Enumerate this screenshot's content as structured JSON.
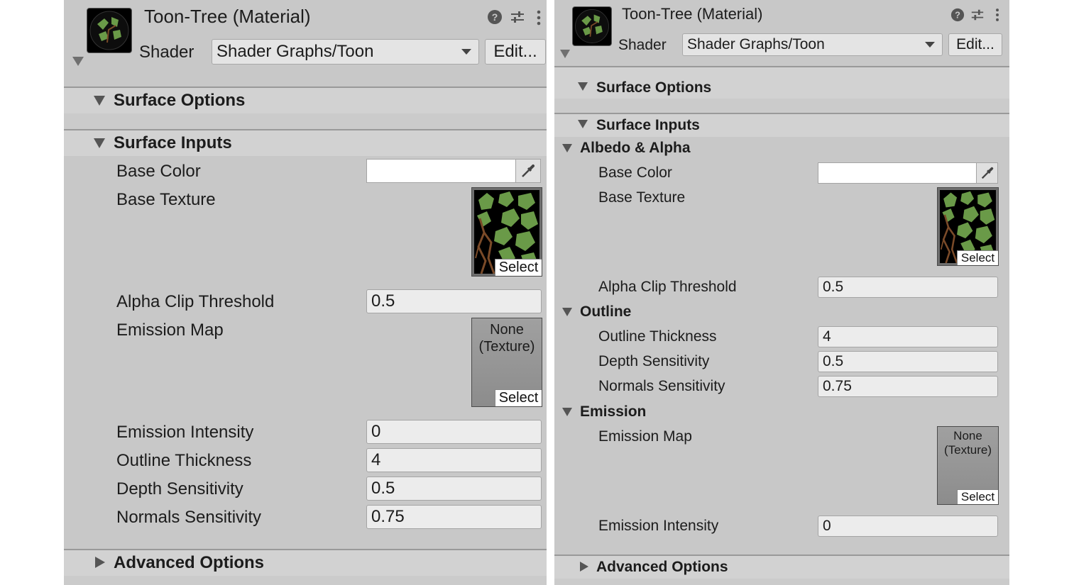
{
  "material": {
    "title": "Toon-Tree (Material)",
    "shader_label": "Shader",
    "shader_value": "Shader Graphs/Toon",
    "edit_label": "Edit..."
  },
  "icons": {
    "help": "help-icon",
    "settings": "sliders-icon",
    "menu": "kebab-menu-icon"
  },
  "left": {
    "sections": {
      "surface_options": "Surface Options",
      "surface_inputs": "Surface Inputs",
      "advanced_options": "Advanced Options"
    },
    "props": {
      "base_color": "Base Color",
      "base_texture": "Base Texture",
      "alpha_clip": {
        "label": "Alpha Clip Threshold",
        "value": "0.5"
      },
      "emission_map": "Emission Map",
      "emission_intensity": {
        "label": "Emission Intensity",
        "value": "0"
      },
      "outline_thickness": {
        "label": "Outline Thickness",
        "value": "4"
      },
      "depth_sensitivity": {
        "label": "Depth Sensitivity",
        "value": "0.5"
      },
      "normals_sensitivity": {
        "label": "Normals Sensitivity",
        "value": "0.75"
      }
    }
  },
  "right": {
    "sections": {
      "surface_options": "Surface Options",
      "surface_inputs": "Surface Inputs",
      "albedo_alpha": "Albedo & Alpha",
      "outline": "Outline",
      "emission": "Emission",
      "advanced_options": "Advanced Options"
    },
    "props": {
      "base_color": "Base Color",
      "base_texture": "Base Texture",
      "alpha_clip": {
        "label": "Alpha Clip Threshold",
        "value": "0.5"
      },
      "outline_thickness": {
        "label": "Outline Thickness",
        "value": "4"
      },
      "depth_sensitivity": {
        "label": "Depth Sensitivity",
        "value": "0.5"
      },
      "normals_sensitivity": {
        "label": "Normals Sensitivity",
        "value": "0.75"
      },
      "emission_map": "Emission Map",
      "emission_intensity": {
        "label": "Emission Intensity",
        "value": "0"
      }
    }
  },
  "texture": {
    "select_label": "Select",
    "none_line1": "None",
    "none_line2": "(Texture)"
  },
  "colors": {
    "panel_bg": "#c8c8c8",
    "base_color": "#ffffff",
    "leaf_green": "#6a9a48",
    "branch_brown": "#7a4a28"
  }
}
